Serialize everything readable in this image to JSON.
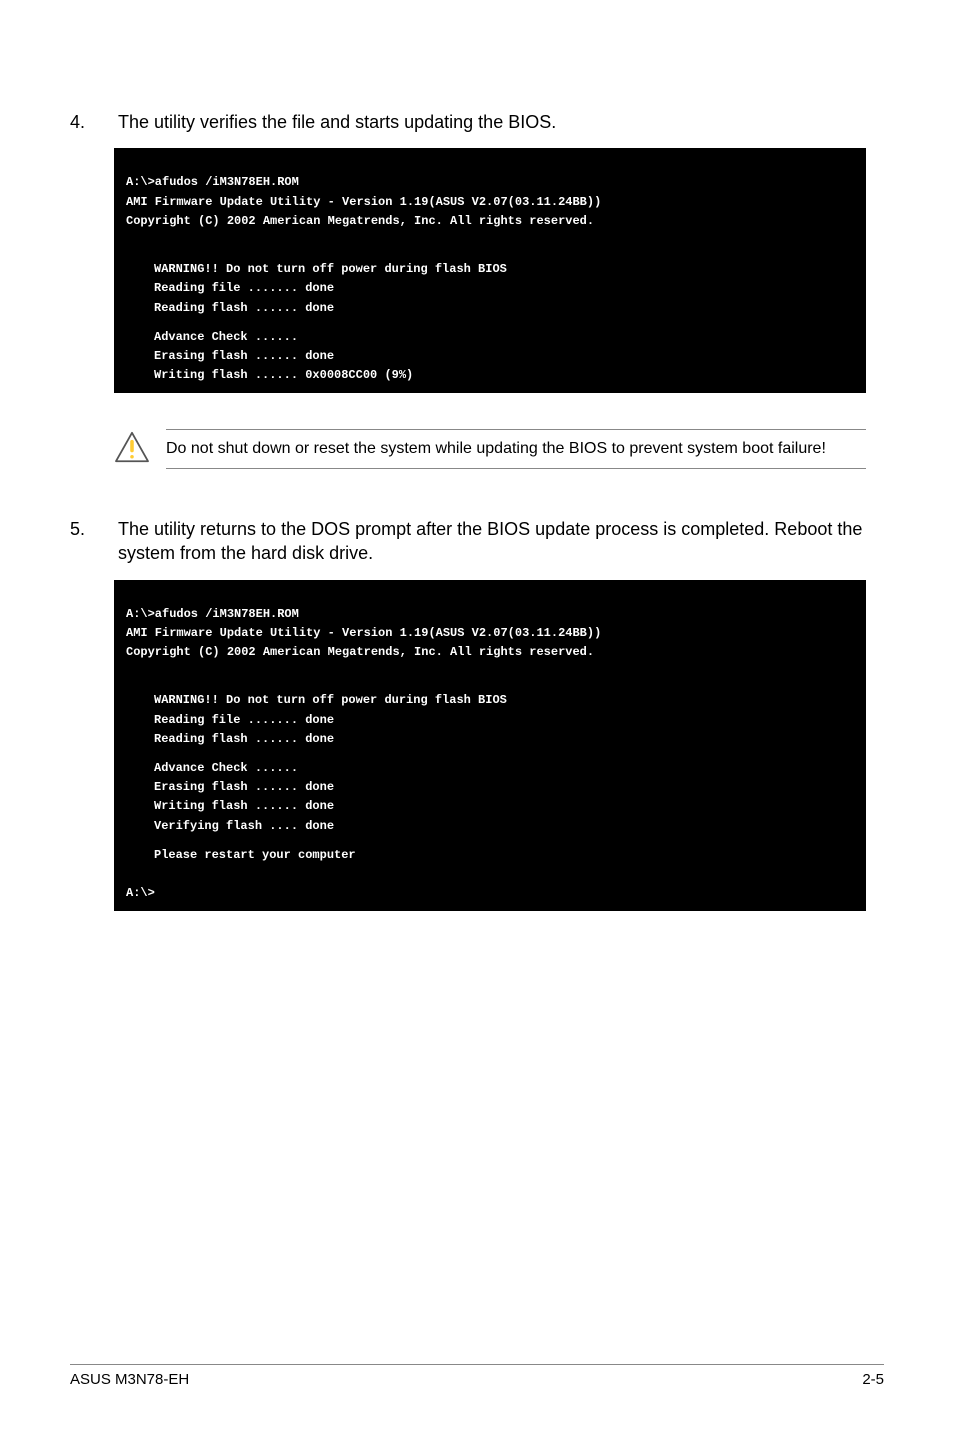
{
  "steps": {
    "s4": {
      "num": "4.",
      "text": "The utility verifies the file and starts updating the BIOS."
    },
    "s5": {
      "num": "5.",
      "text": "The utility returns to the DOS prompt after the BIOS update process is completed. Reboot the system from the hard disk drive."
    }
  },
  "terminal1": {
    "l1": "A:\\>afudos /iM3N78EH.ROM",
    "l2": "AMI Firmware Update Utility - Version 1.19(ASUS V2.07(03.11.24BB))",
    "l3": "Copyright (C) 2002 American Megatrends, Inc. All rights reserved.",
    "l4": "WARNING!! Do not turn off power during flash BIOS",
    "l5": "Reading file ....... done",
    "l6": "Reading flash ...... done",
    "l7": "Advance Check ......",
    "l8": "Erasing flash ...... done",
    "l9": "Writing flash ...... 0x0008CC00 (9%)"
  },
  "note": {
    "text": "Do not shut down or reset the system while updating the BIOS to prevent system boot failure!"
  },
  "terminal2": {
    "l1": "A:\\>afudos /iM3N78EH.ROM",
    "l2": "AMI Firmware Update Utility - Version 1.19(ASUS V2.07(03.11.24BB))",
    "l3": "Copyright (C) 2002 American Megatrends, Inc. All rights reserved.",
    "l4": "WARNING!! Do not turn off power during flash BIOS",
    "l5": "Reading file ....... done",
    "l6": "Reading flash ...... done",
    "l7": "Advance Check ......",
    "l8": "Erasing flash ...... done",
    "l9": "Writing flash ...... done",
    "l10": "Verifying flash .... done",
    "l11": "Please restart your computer",
    "l12": "A:\\>"
  },
  "footer": {
    "left": "ASUS M3N78-EH",
    "right": "2-5"
  }
}
